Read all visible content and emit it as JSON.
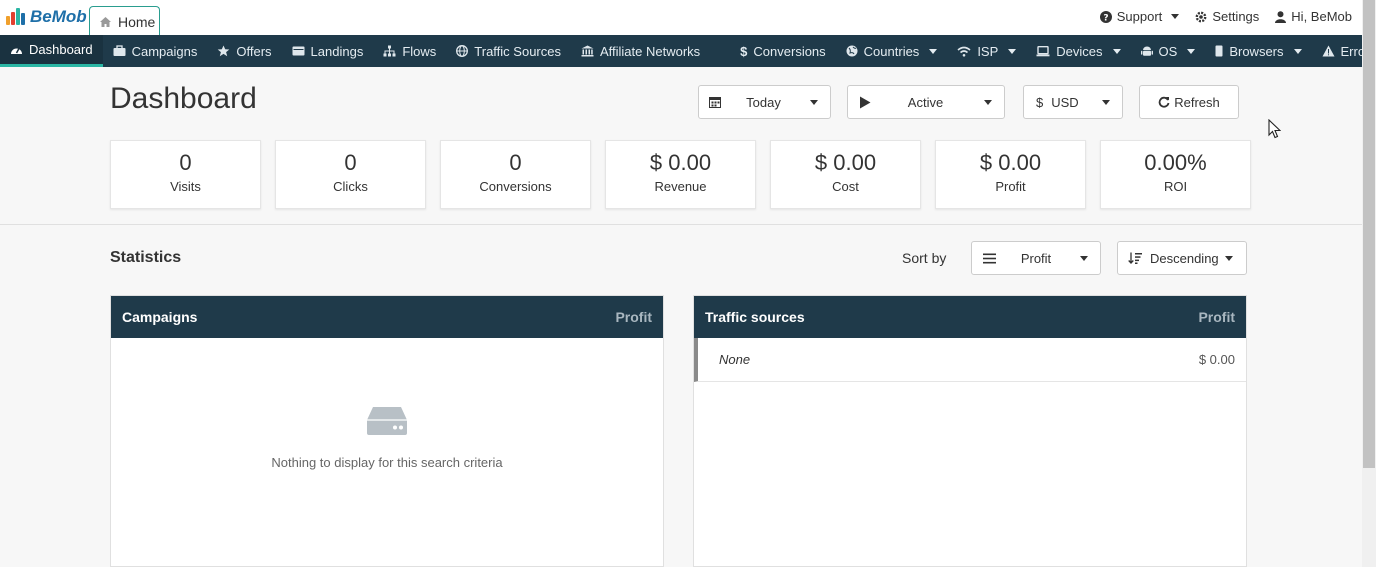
{
  "brand": {
    "name": "BeMob",
    "accent": "#2bb6a4",
    "nav_bg": "#1f3a4a"
  },
  "tabs": [
    {
      "label": "Home",
      "icon": "home-icon"
    }
  ],
  "top_menu": {
    "support": "Support",
    "settings": "Settings",
    "user": "Hi, BeMob"
  },
  "nav": {
    "dashboard": "Dashboard",
    "campaigns": "Campaigns",
    "offers": "Offers",
    "landings": "Landings",
    "flows": "Flows",
    "traffic_sources": "Traffic Sources",
    "affiliate_networks": "Affiliate Networks",
    "conversions": "Conversions",
    "countries": "Countries",
    "isp": "ISP",
    "devices": "Devices",
    "os": "OS",
    "browsers": "Browsers",
    "errors": "Errors"
  },
  "page": {
    "title": "Dashboard"
  },
  "filters": {
    "date": "Today",
    "status": "Active",
    "currency_symbol": "$",
    "currency": "USD",
    "refresh": "Refresh"
  },
  "kpis": [
    {
      "value": "0",
      "label": "Visits"
    },
    {
      "value": "0",
      "label": "Clicks"
    },
    {
      "value": "0",
      "label": "Conversions"
    },
    {
      "value": "$ 0.00",
      "label": "Revenue"
    },
    {
      "value": "$ 0.00",
      "label": "Cost"
    },
    {
      "value": "$ 0.00",
      "label": "Profit"
    },
    {
      "value": "0.00%",
      "label": "ROI"
    }
  ],
  "statistics": {
    "title": "Statistics",
    "sort_by_label": "Sort by",
    "sort_field": "Profit",
    "sort_order": "Descending"
  },
  "campaigns_panel": {
    "title": "Campaigns",
    "column": "Profit",
    "empty_text": "Nothing to display for this search criteria"
  },
  "traffic_panel": {
    "title": "Traffic sources",
    "column": "Profit",
    "rows": [
      {
        "name": "None",
        "value": "$ 0.00"
      }
    ]
  }
}
